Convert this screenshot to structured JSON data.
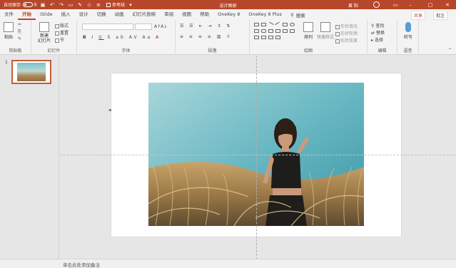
{
  "titlebar": {
    "autosave": "自动保存",
    "autosave_state": "关",
    "checkbox_label": "参考线",
    "doc_title": "设计图册",
    "user": "黄 阳",
    "bg_color": "#b7472a"
  },
  "tabs": [
    "文件",
    "开始",
    "iSlide",
    "插入",
    "设计",
    "切换",
    "动画",
    "幻灯片放映",
    "审阅",
    "视图",
    "帮助",
    "OneKey 8",
    "OneKey 8 Plus"
  ],
  "active_tab": "开始",
  "search_label": "搜索",
  "share_label": "共享",
  "comment_label": "批注",
  "ribbon": {
    "clipboard": {
      "label": "剪贴板",
      "paste": "粘贴"
    },
    "slides": {
      "label": "幻灯片",
      "new_slide": "新建\n幻灯片",
      "layout": "版式",
      "reset": "重置",
      "section": "节"
    },
    "font": {
      "label": "字体",
      "buttons": [
        "B",
        "I",
        "U",
        "S",
        "ab",
        "AV",
        "Aa",
        "A"
      ]
    },
    "paragraph": {
      "label": "段落"
    },
    "drawing": {
      "label": "绘图",
      "arrange": "排列",
      "quick_styles": "快速样式",
      "fill": "形状填充",
      "outline": "形状轮廓",
      "effects": "形状效果"
    },
    "editing": {
      "label": "编辑",
      "find": "查找",
      "replace": "替换",
      "select": "选择"
    },
    "voice": {
      "label": "语音",
      "dictate": "听写"
    }
  },
  "slide_panel": {
    "slide_number": "1"
  },
  "status_bar": {
    "notes_placeholder": "单击此处添加备注"
  }
}
